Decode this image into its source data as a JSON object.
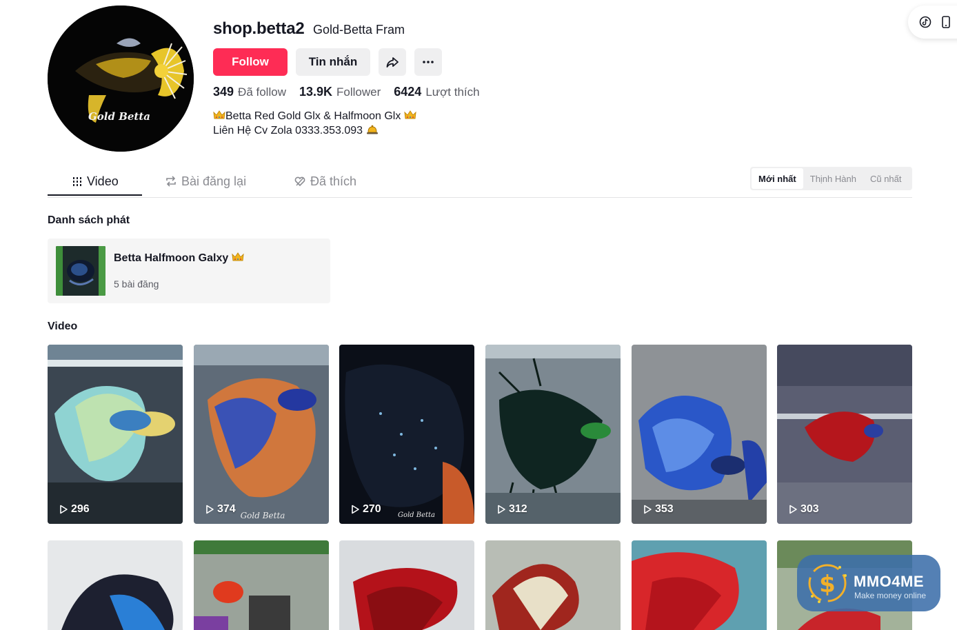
{
  "profile": {
    "username": "shop.betta2",
    "nickname": "Gold-Betta Fram",
    "avatar_text": "Gold Betta",
    "follow_label": "Follow",
    "message_label": "Tin nhắn",
    "stats": [
      {
        "value": "349",
        "label": "Đã follow"
      },
      {
        "value": "13.9K",
        "label": "Follower"
      },
      {
        "value": "6424",
        "label": "Lượt thích"
      }
    ],
    "bio_line1": "Betta Red Gold Glx & Halfmoon Glx",
    "bio_line2": "Liên Hệ Cv Zola 0333.353.093"
  },
  "tabs": [
    {
      "label": "Video",
      "icon": "grid-icon",
      "active": true
    },
    {
      "label": "Bài đăng lại",
      "icon": "repost-icon",
      "active": false
    },
    {
      "label": "Đã thích",
      "icon": "liked-icon",
      "active": false
    }
  ],
  "sort": {
    "options": [
      "Mới nhất",
      "Thịnh Hành",
      "Cũ nhất"
    ],
    "selected": "Mới nhất"
  },
  "playlists": {
    "heading": "Danh sách phát",
    "items": [
      {
        "title": "Betta Halfmoon Galxy",
        "count": "5 bài đăng"
      }
    ]
  },
  "videos": {
    "heading": "Video",
    "items": [
      {
        "views": "296"
      },
      {
        "views": "374"
      },
      {
        "views": "270"
      },
      {
        "views": "312"
      },
      {
        "views": "353"
      },
      {
        "views": "303"
      }
    ],
    "card_watermark": "Gold Betta"
  },
  "watermark": {
    "title": "MMO4ME",
    "subtitle": "Make money online"
  },
  "colors": {
    "accent": "#fe2c55",
    "text": "#161823",
    "muted": "#8a8b91"
  }
}
